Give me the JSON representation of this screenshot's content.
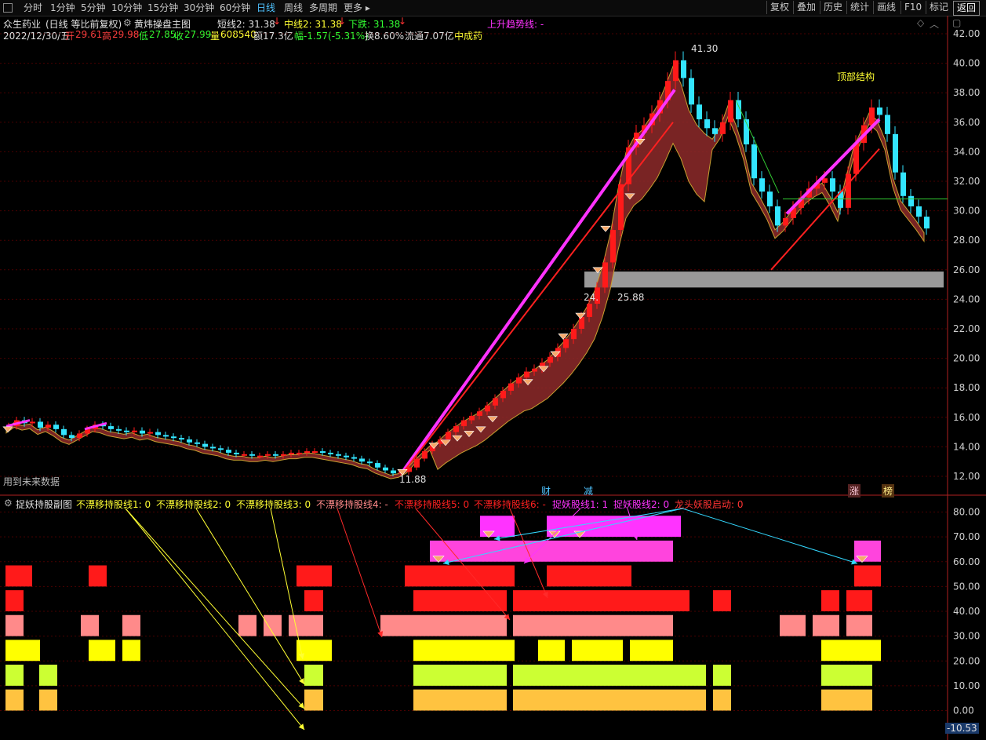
{
  "toolbar": {
    "left": [
      "分时",
      "1分钟",
      "5分钟",
      "10分钟",
      "15分钟",
      "30分钟",
      "60分钟",
      "日线",
      "周线",
      "多周期",
      "更多 ▸"
    ],
    "active": "日线",
    "right": [
      "复权",
      "叠加",
      "历史",
      "统计",
      "画线",
      "F10",
      "标记",
      "返回"
    ]
  },
  "main": {
    "stock": "众生药业",
    "mode": "(日线 等比前复权)",
    "indicator_name": "黄炜操盘主图",
    "short_line": "短线2: 31.38",
    "mid_line": "中线2: 31.38",
    "down_line": "下跌: 31.38",
    "up_trend": "上升趋势线: -",
    "date": "2022/12/30/五",
    "open_label": "开",
    "open": "29.61",
    "high_label": "高",
    "high": "29.98",
    "low_label": "低",
    "low": "27.85",
    "close_label": "收",
    "close": "27.99",
    "vol_label": "量",
    "vol": "608540",
    "amount": "额17.3亿",
    "change": "幅-1.57(-5.31%)",
    "turnover": "换8.60%",
    "float": "流通7.07亿",
    "sector": "中成药",
    "future_note": "用到未来数据",
    "peak_label": "41.30",
    "low_label2": "11.88",
    "zone_lo": "24.",
    "zone_hi": "25.88",
    "top_structure": "顶部结构",
    "marker_cai": "财",
    "marker_jian": "减",
    "marker_zhang": "涨",
    "marker_bang": "榜"
  },
  "sub": {
    "title": "捉妖持股副图",
    "labels": [
      {
        "text": "不漂移持股线1: 0",
        "color": "#ffff33"
      },
      {
        "text": "不漂移持股线2: 0",
        "color": "#ffff33"
      },
      {
        "text": "不漂移持股线3: 0",
        "color": "#ffff33"
      },
      {
        "text": "不漂移持股线4: -",
        "color": "#ff8a8a"
      },
      {
        "text": "不漂移持股线5: 0",
        "color": "#ff2020"
      },
      {
        "text": "不漂移持股线6: -",
        "color": "#ff2020"
      },
      {
        "text": "捉妖股线1: 1",
        "color": "#ff33ff"
      },
      {
        "text": "捉妖股线2: 0",
        "color": "#ff33ff"
      },
      {
        "text": "龙头妖股启动: 0",
        "color": "#ff3333"
      }
    ],
    "last_value": "-10.53"
  },
  "chart_data": [
    {
      "type": "candlestick",
      "title": "黄炜操盘主图",
      "y_axis_ticks": [
        "42.00",
        "40.00",
        "38.00",
        "36.00",
        "34.00",
        "32.00",
        "30.00",
        "28.00",
        "26.00",
        "24.00",
        "22.00",
        "20.00",
        "18.00",
        "16.00",
        "14.00",
        "12.00"
      ],
      "ylim": [
        11.0,
        42.6
      ],
      "price_path": [
        [
          0,
          15.4
        ],
        [
          10,
          15.8
        ],
        [
          20,
          15.6
        ],
        [
          30,
          15.7
        ],
        [
          40,
          15.3
        ],
        [
          50,
          15.5
        ],
        [
          60,
          15.2
        ],
        [
          70,
          14.8
        ],
        [
          80,
          14.6
        ],
        [
          90,
          14.9
        ],
        [
          100,
          15.2
        ],
        [
          110,
          15.5
        ],
        [
          120,
          15.4
        ],
        [
          130,
          15.2
        ],
        [
          140,
          15.1
        ],
        [
          150,
          15.0
        ],
        [
          160,
          15.1
        ],
        [
          170,
          14.9
        ],
        [
          180,
          15.0
        ],
        [
          190,
          14.8
        ],
        [
          200,
          14.7
        ],
        [
          210,
          14.6
        ],
        [
          220,
          14.5
        ],
        [
          230,
          14.3
        ],
        [
          240,
          14.2
        ],
        [
          250,
          14.0
        ],
        [
          260,
          13.9
        ],
        [
          270,
          13.8
        ],
        [
          280,
          13.6
        ],
        [
          290,
          13.5
        ],
        [
          300,
          13.5
        ],
        [
          310,
          13.4
        ],
        [
          320,
          13.4
        ],
        [
          330,
          13.5
        ],
        [
          340,
          13.4
        ],
        [
          350,
          13.5
        ],
        [
          360,
          13.6
        ],
        [
          370,
          13.6
        ],
        [
          380,
          13.7
        ],
        [
          390,
          13.7
        ],
        [
          400,
          13.6
        ],
        [
          410,
          13.5
        ],
        [
          420,
          13.4
        ],
        [
          430,
          13.3
        ],
        [
          440,
          13.2
        ],
        [
          450,
          13.0
        ],
        [
          460,
          12.9
        ],
        [
          470,
          12.6
        ],
        [
          480,
          12.4
        ],
        [
          490,
          12.2
        ],
        [
          500,
          12.3
        ],
        [
          510,
          12.6
        ],
        [
          520,
          13.2
        ],
        [
          530,
          13.7
        ],
        [
          540,
          14.2
        ],
        [
          550,
          14.5
        ],
        [
          560,
          15.0
        ],
        [
          570,
          15.4
        ],
        [
          580,
          15.8
        ],
        [
          590,
          16.1
        ],
        [
          600,
          16.4
        ],
        [
          610,
          16.8
        ],
        [
          620,
          17.3
        ],
        [
          630,
          17.8
        ],
        [
          640,
          18.3
        ],
        [
          650,
          18.7
        ],
        [
          660,
          19.1
        ],
        [
          670,
          19.3
        ],
        [
          680,
          19.7
        ],
        [
          690,
          20.1
        ],
        [
          700,
          20.7
        ],
        [
          710,
          21.3
        ],
        [
          720,
          22.0
        ],
        [
          730,
          22.8
        ],
        [
          740,
          23.7
        ],
        [
          750,
          24.8
        ],
        [
          760,
          26.5
        ],
        [
          770,
          28.7
        ],
        [
          780,
          31.8
        ],
        [
          790,
          34.3
        ],
        [
          800,
          35.3
        ],
        [
          810,
          35.8
        ],
        [
          820,
          36.6
        ],
        [
          830,
          37.5
        ],
        [
          840,
          38.8
        ],
        [
          850,
          40.2
        ],
        [
          860,
          39.0
        ],
        [
          870,
          37.2
        ],
        [
          880,
          36.2
        ],
        [
          890,
          35.6
        ],
        [
          900,
          35.2
        ],
        [
          910,
          36.0
        ],
        [
          920,
          37.5
        ],
        [
          930,
          36.2
        ],
        [
          940,
          34.5
        ],
        [
          950,
          32.2
        ],
        [
          960,
          31.3
        ],
        [
          970,
          30.3
        ],
        [
          980,
          29.0
        ],
        [
          990,
          29.5
        ],
        [
          1000,
          30.2
        ],
        [
          1010,
          30.9
        ],
        [
          1020,
          31.5
        ],
        [
          1030,
          31.9
        ],
        [
          1040,
          32.2
        ],
        [
          1050,
          31.3
        ],
        [
          1060,
          30.2
        ],
        [
          1070,
          32.5
        ],
        [
          1080,
          34.6
        ],
        [
          1090,
          35.8
        ],
        [
          1100,
          37.0
        ],
        [
          1110,
          36.5
        ],
        [
          1120,
          35.2
        ],
        [
          1130,
          32.6
        ],
        [
          1140,
          31.0
        ],
        [
          1150,
          30.3
        ],
        [
          1160,
          29.6
        ],
        [
          1170,
          28.8
        ]
      ],
      "support_zone": [
        24.8,
        25.88
      ],
      "peak": 41.3,
      "trough": 11.88
    },
    {
      "type": "bar",
      "title": "捉妖持股副图",
      "y_axis_ticks": [
        "80.00",
        "70.00",
        "60.00",
        "50.00",
        "40.00",
        "30.00",
        "20.00",
        "10.00",
        "0.00",
        "-10.53"
      ],
      "ylim": [
        -10.53,
        84.0
      ],
      "series": [
        {
          "name": "不漂移持股线1",
          "level": 0,
          "color": "#ffc340",
          "segments": [
            [
              7,
              30
            ],
            [
              50,
              73
            ],
            [
              388,
              412
            ],
            [
              527,
              646
            ],
            [
              654,
              900
            ],
            [
              909,
              932
            ],
            [
              1047,
              1112
            ]
          ]
        },
        {
          "name": "不漂移持股线2",
          "level": 10,
          "color": "#ccff33",
          "segments": [
            [
              7,
              30
            ],
            [
              50,
              73
            ],
            [
              388,
              412
            ],
            [
              527,
              646
            ],
            [
              654,
              900
            ],
            [
              909,
              932
            ],
            [
              1047,
              1112
            ]
          ]
        },
        {
          "name": "不漂移持股线3",
          "level": 20,
          "color": "#ffff00",
          "segments": [
            [
              7,
              51
            ],
            [
              113,
              147
            ],
            [
              156,
              179
            ],
            [
              378,
              423
            ],
            [
              527,
              656
            ],
            [
              686,
              720
            ],
            [
              729,
              794
            ],
            [
              803,
              858
            ],
            [
              1047,
              1123
            ]
          ]
        },
        {
          "name": "不漂移持股线4",
          "level": 30,
          "color": "#ff8a8a",
          "segments": [
            [
              7,
              30
            ],
            [
              103,
              126
            ],
            [
              156,
              179
            ],
            [
              304,
              327
            ],
            [
              336,
              359
            ],
            [
              368,
              412
            ],
            [
              485,
              646
            ],
            [
              654,
              858
            ],
            [
              994,
              1027
            ],
            [
              1036,
              1070
            ],
            [
              1079,
              1112
            ]
          ]
        },
        {
          "name": "不漂移持股线5",
          "level": 40,
          "color": "#ff1a1a",
          "segments": [
            [
              7,
              30
            ],
            [
              388,
              412
            ],
            [
              527,
              646
            ],
            [
              654,
              879
            ],
            [
              909,
              932
            ],
            [
              1047,
              1070
            ],
            [
              1079,
              1112
            ]
          ]
        },
        {
          "name": "不漂移持股线6",
          "level": 50,
          "color": "#ff1a1a",
          "segments": [
            [
              7,
              41
            ],
            [
              113,
              136
            ],
            [
              378,
              423
            ],
            [
              516,
              656
            ],
            [
              697,
              805
            ],
            [
              1089,
              1123
            ]
          ]
        },
        {
          "name": "捉妖股线1",
          "level": 60,
          "color": "#ff44dd",
          "segments": [
            [
              548,
              858
            ],
            [
              1089,
              1123
            ]
          ]
        },
        {
          "name": "捉妖股线2",
          "level": 70,
          "color": "#ff33ff",
          "segments": [
            [
              612,
              656
            ],
            [
              697,
              868
            ]
          ]
        }
      ]
    }
  ]
}
